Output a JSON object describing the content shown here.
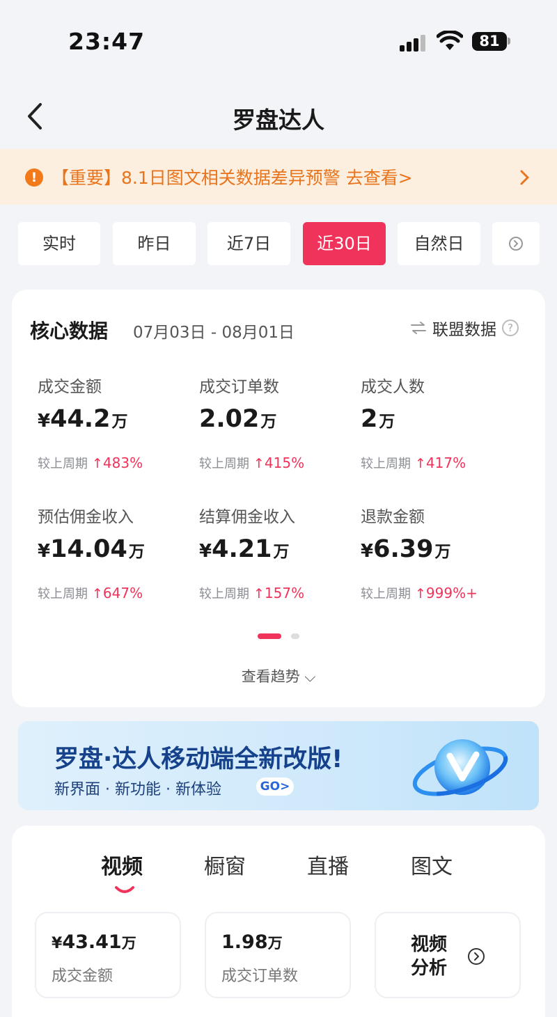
{
  "status_bar": {
    "time": "23:47",
    "battery": "81"
  },
  "nav": {
    "title": "罗盘达人"
  },
  "notice": {
    "icon": "alert-icon",
    "text": "【重要】8.1日图文相关数据差异预警 去查看>"
  },
  "tabs": [
    {
      "label": "实时",
      "active": false
    },
    {
      "label": "昨日",
      "active": false
    },
    {
      "label": "近7日",
      "active": false
    },
    {
      "label": "近30日",
      "active": true
    },
    {
      "label": "自然日",
      "active": false
    }
  ],
  "core": {
    "title": "核心数据",
    "date_range": "07月03日 - 08月01日",
    "alliance_label": "联盟数据",
    "help_glyph": "?",
    "compare_label": "较上周期",
    "metrics": [
      {
        "label": "成交金额",
        "currency": "¥",
        "value": "44.2",
        "unit": "万",
        "change": "483%"
      },
      {
        "label": "成交订单数",
        "currency": "",
        "value": "2.02",
        "unit": "万",
        "change": "415%"
      },
      {
        "label": "成交人数",
        "currency": "",
        "value": "2",
        "unit": "万",
        "change": "417%"
      },
      {
        "label": "预估佣金收入",
        "currency": "¥",
        "value": "14.04",
        "unit": "万",
        "change": "647%"
      },
      {
        "label": "结算佣金收入",
        "currency": "¥",
        "value": "4.21",
        "unit": "万",
        "change": "157%"
      },
      {
        "label": "退款金额",
        "currency": "¥",
        "value": "6.39",
        "unit": "万",
        "change": "999%+"
      }
    ],
    "trend_label": "查看趋势 ⌵"
  },
  "banner": {
    "title": "罗盘·达人移动端全新改版!",
    "subtitle": "新界面 · 新功能 · 新体验",
    "go_label": "GO>"
  },
  "content": {
    "tabs": [
      {
        "label": "视频",
        "active": true
      },
      {
        "label": "橱窗",
        "active": false
      },
      {
        "label": "直播",
        "active": false
      },
      {
        "label": "图文",
        "active": false
      }
    ],
    "stats": [
      {
        "currency": "¥",
        "value": "43.41",
        "unit": "万",
        "label": "成交金额"
      },
      {
        "currency": "",
        "value": "1.98",
        "unit": "万",
        "label": "成交订单数"
      }
    ],
    "video_analysis_label": "视频\n分析"
  },
  "colors": {
    "accent": "#f0335a",
    "notice_bg": "#fcefdf",
    "notice_text": "#e8741e",
    "banner_text": "#16428c"
  }
}
